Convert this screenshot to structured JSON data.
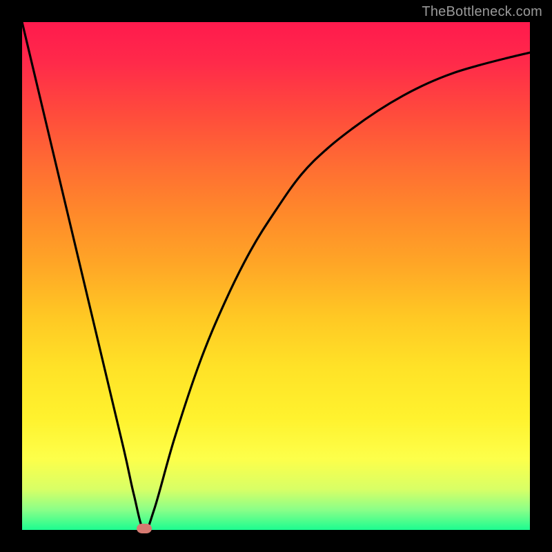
{
  "watermark": "TheBottleneck.com",
  "colors": {
    "page_bg": "#000000",
    "curve_stroke": "#000000",
    "marker_fill": "#d77a71",
    "watermark_text": "#9a9a9a"
  },
  "chart_data": {
    "type": "line",
    "title": "",
    "xlabel": "",
    "ylabel": "",
    "xlim": [
      0,
      100
    ],
    "ylim": [
      0,
      100
    ],
    "grid": false,
    "legend": false,
    "series": [
      {
        "name": "bottleneck-curve",
        "x": [
          0,
          5,
          10,
          15,
          20,
          22,
          24,
          26,
          30,
          35,
          40,
          45,
          50,
          55,
          60,
          65,
          70,
          75,
          80,
          85,
          90,
          95,
          100
        ],
        "y": [
          100,
          79,
          58,
          37,
          16,
          7,
          0,
          4,
          18,
          33,
          45,
          55,
          63,
          70,
          75,
          79,
          82.5,
          85.5,
          88,
          90,
          91.5,
          92.8,
          94
        ]
      }
    ],
    "marker": {
      "x": 24,
      "y": 0
    },
    "background_gradient_meaning": "red-high-to-green-low"
  }
}
